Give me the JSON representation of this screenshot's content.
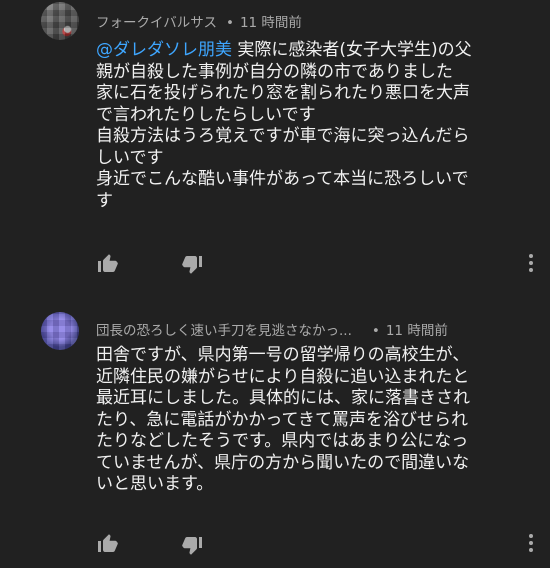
{
  "comments": [
    {
      "author": "フォークイバルサス",
      "dot": "•",
      "time": "11 時間前",
      "mention": "@ダレダソレ朋美",
      "text_after_mention": " 実際に感染者(女子大学生)の父\n親が自殺した事例が自分の隣の市でありました\n家に石を投げられたり窓を割られたり悪口を大声\nで言われたりしたらしいです\n自殺方法はうろ覚えですが車で海に突っ込んだら\nしいです\n身近でこんな酷い事件があって本当に恐ろしいで\nす"
    },
    {
      "author": "団長の恐ろしく速い手刀を見逃さなかっ...",
      "dot": "•",
      "time": "11 時間前",
      "text": "田舎ですが、県内第一号の留学帰りの高校生が、\n近隣住民の嫌がらせにより自殺に追い込まれたと\n最近耳にしました。具体的には、家に落書きされ\nたり、急に電話がかかってきて罵声を浴びせられ\nたりなどしたそうです。県内ではあまり公になっ\nていませんが、県庁の方から聞いたので間違いな\nいと思います。"
    }
  ],
  "icons": {
    "like": "thumbs-up-icon",
    "dislike": "thumbs-down-icon",
    "more": "more-vert-icon"
  },
  "colors": {
    "background": "#212121",
    "text": "#f1f1f1",
    "meta": "#aaaaaa",
    "mention": "#3ea6ff",
    "icon": "#aaaaaa"
  }
}
